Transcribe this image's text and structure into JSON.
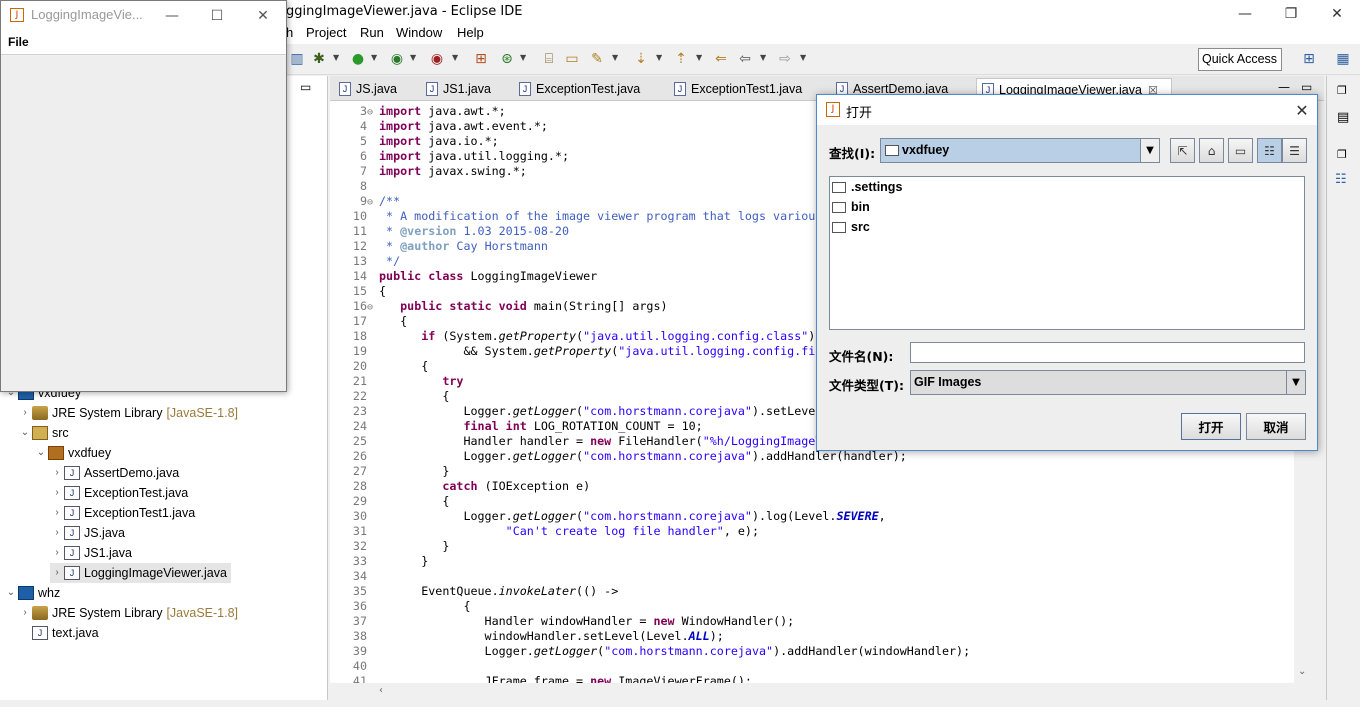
{
  "eclipse": {
    "title": "ggingImageViewer.java - Eclipse IDE",
    "menus": [
      "h",
      "Project",
      "Run",
      "Window",
      "Help"
    ],
    "quick_access": "Quick Access",
    "tabs": [
      "JS.java",
      "JS1.java",
      "ExceptionTest.java",
      "ExceptionTest1.java",
      "AssertDemo.java",
      "LoggingImageViewer.java"
    ],
    "tab_close": "☒"
  },
  "package_explorer": {
    "items": [
      {
        "label": "vxdfuey",
        "deco": ""
      },
      {
        "label": "JRE System Library",
        "deco": "[JavaSE-1.8]"
      },
      {
        "label": "src",
        "deco": ""
      },
      {
        "label": "vxdfuey",
        "deco": ""
      },
      {
        "label": "AssertDemo.java",
        "deco": ""
      },
      {
        "label": "ExceptionTest.java",
        "deco": ""
      },
      {
        "label": "ExceptionTest1.java",
        "deco": ""
      },
      {
        "label": "JS.java",
        "deco": ""
      },
      {
        "label": "JS1.java",
        "deco": ""
      },
      {
        "label": "LoggingImageViewer.java",
        "deco": ""
      },
      {
        "label": "whz",
        "deco": ""
      },
      {
        "label": "JRE System Library",
        "deco": "[JavaSE-1.8]"
      },
      {
        "label": "text.java",
        "deco": ""
      }
    ]
  },
  "editor": {
    "line_numbers": [
      "3",
      "4",
      "5",
      "6",
      "7",
      "8",
      "9",
      "10",
      "11",
      "12",
      "13",
      "14",
      "15",
      "16",
      "17",
      "18",
      "19",
      "20",
      "21",
      "22",
      "23",
      "24",
      "25",
      "26",
      "27",
      "28",
      "29",
      "30",
      "31",
      "32",
      "33",
      "34",
      "35",
      "36",
      "37",
      "38",
      "39",
      "40",
      "41"
    ]
  },
  "liv_window": {
    "title": "LoggingImageVie...",
    "menu_file": "File"
  },
  "dialog": {
    "title": "打开",
    "look_in_label": "查找(I):",
    "look_in_value": "vxdfuey",
    "files": [
      ".settings",
      "bin",
      "src"
    ],
    "filename_label": "文件名(N):",
    "filename_value": "",
    "filetype_label": "文件类型(T):",
    "filetype_value": "GIF Images",
    "open_button": "打开",
    "cancel_button": "取消"
  }
}
